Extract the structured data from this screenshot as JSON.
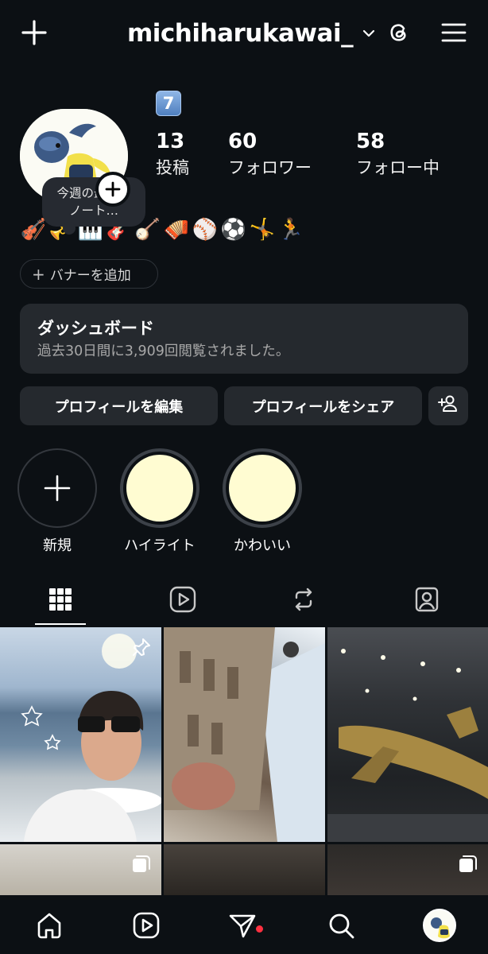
{
  "header": {
    "username": "michiharukawai_",
    "icons": [
      "plus-icon",
      "chevron-down-icon",
      "threads-icon",
      "hamburger-menu-icon"
    ]
  },
  "profile": {
    "note": "今週の最初の\nノート…",
    "badge": "7",
    "stats": [
      {
        "num": "13",
        "label": "投稿"
      },
      {
        "num": "60",
        "label": "フォロワー"
      },
      {
        "num": "58",
        "label": "フォロー中"
      }
    ],
    "emojis": [
      "🎻",
      "🎺",
      "🎹",
      "🎸",
      "🪕",
      "🪗",
      "⚾",
      "⚽",
      "🤸",
      "🏃"
    ]
  },
  "banner": {
    "label": "バナーを追加"
  },
  "dashboard": {
    "title": "ダッシュボード",
    "subtitle": "過去30日間に3,909回閲覧されました。"
  },
  "buttons": {
    "edit": "プロフィールを編集",
    "share": "プロフィールをシェア"
  },
  "highlights": [
    {
      "label": "新規",
      "type": "new"
    },
    {
      "label": "ハイライト",
      "type": "image",
      "color": "#fffcd2"
    },
    {
      "label": "かわいい",
      "type": "image",
      "color": "#fffcd2"
    }
  ],
  "tabs": [
    "grid-icon",
    "reels-icon",
    "reposts-icon",
    "tagged-icon"
  ],
  "grid_posts": [
    {
      "icon": "pin-icon"
    },
    {
      "icon": ""
    },
    {
      "icon": ""
    },
    {
      "icon": "carousel-icon"
    },
    {
      "icon": ""
    },
    {
      "icon": "carousel-icon"
    }
  ],
  "bottom_nav": [
    "home-icon",
    "reels-icon",
    "direct-icon",
    "search-icon",
    "profile-avatar"
  ],
  "colors": {
    "background": "#0c1014",
    "surface": "#25292e",
    "notification": "#ff3040",
    "highlight": "#fffcd2"
  }
}
